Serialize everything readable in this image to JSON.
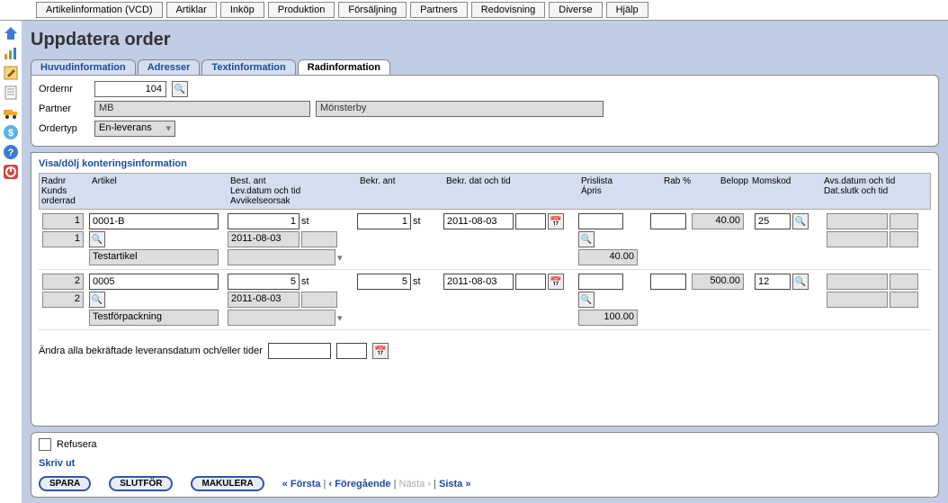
{
  "topTabs": [
    "Artikelinformation (VCD)",
    "Artiklar",
    "Inköp",
    "Produktion",
    "Försäljning",
    "Partners",
    "Redovisning",
    "Diverse",
    "Hjälp"
  ],
  "pageTitle": "Uppdatera order",
  "innerTabs": {
    "t0": "Huvudinformation",
    "t1": "Adresser",
    "t2": "Textinformation",
    "t3": "Radinformation"
  },
  "form": {
    "ordernr_label": "Ordernr",
    "ordernr": "104",
    "partner_label": "Partner",
    "partner_code": "MB",
    "partner_name": "Mönsterby",
    "ordertyp_label": "Ordertyp",
    "ordertyp": "En-leverans"
  },
  "toggle_label": "Visa/dölj konteringsinformation",
  "gridHeaders": {
    "radnr": "Radnr",
    "kunds": "Kunds orderrad",
    "artikel": "Artikel",
    "best": "Best. ant",
    "levdat": "Lev.datum och tid",
    "avvik": "Avvikelseorsak",
    "bekrant": "Bekr. ant",
    "bekrdat": "Bekr. dat och tid",
    "prislista": "Prislista",
    "apris": "Ápris",
    "rab": "Rab %",
    "belopp": "Belopp",
    "momskod": "Momskod",
    "avsdatum": "Avs.datum och tid",
    "datslut": "Dat.slutk och tid"
  },
  "rows": [
    {
      "radnr": "1",
      "kunds": "1",
      "artikel": "0001-B",
      "artikel_name": "Testartikel",
      "best_ant": "1",
      "unit": "st",
      "lev_dat": "2011-08-03",
      "bekr_ant": "1",
      "bekr_dat": "2011-08-03",
      "apris": "40.00",
      "belopp": "40.00",
      "momskod": "25"
    },
    {
      "radnr": "2",
      "kunds": "2",
      "artikel": "0005",
      "artikel_name": "Testförpackning",
      "best_ant": "5",
      "unit": "st",
      "lev_dat": "2011-08-03",
      "bekr_ant": "5",
      "bekr_dat": "2011-08-03",
      "apris": "100.00",
      "belopp": "500.00",
      "momskod": "12"
    }
  ],
  "change_all_label": "Ändra alla bekräftade leveransdatum och/eller tider",
  "refusera_label": "Refusera",
  "print_label": "Skriv ut",
  "buttons": {
    "spara": "SPARA",
    "slutfor": "SLUTFÖR",
    "makulera": "MAKULERA"
  },
  "pager": {
    "first": "« Första",
    "prev": "‹ Föregående",
    "next": "Nästa ›",
    "last": "Sista »"
  }
}
